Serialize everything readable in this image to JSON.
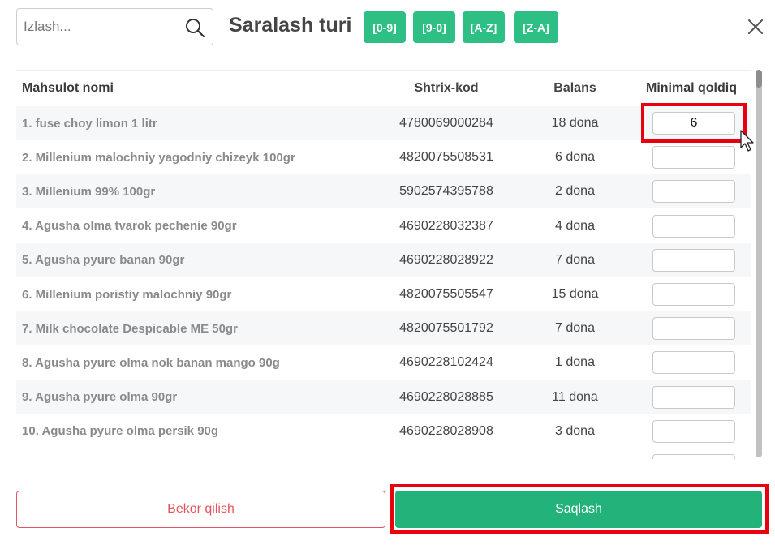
{
  "search": {
    "placeholder": "Izlash...",
    "icon": "search-icon"
  },
  "sort": {
    "title": "Saralash turi",
    "buttons": [
      "[0-9]",
      "[9-0]",
      "[A-Z]",
      "[Z-A]"
    ]
  },
  "close": {
    "icon": "close-icon"
  },
  "table": {
    "headers": [
      "Mahsulot nomi",
      "Shtrix-kod",
      "Balans",
      "Minimal qoldiq"
    ],
    "rows": [
      {
        "name": "1. fuse choy limon 1 litr",
        "barcode": "4780069000284",
        "balance": "18 dona",
        "min": "6"
      },
      {
        "name": "2. Millenium malochniy yagodniy chizeyk 100gr",
        "barcode": "4820075508531",
        "balance": "6 dona",
        "min": ""
      },
      {
        "name": "3. Millenium 99% 100gr",
        "barcode": "5902574395788",
        "balance": "2 dona",
        "min": ""
      },
      {
        "name": "4. Agusha olma tvarok pechenie 90gr",
        "barcode": "4690228032387",
        "balance": "4 dona",
        "min": ""
      },
      {
        "name": "5. Agusha pyure banan 90gr",
        "barcode": "4690228028922",
        "balance": "7 dona",
        "min": ""
      },
      {
        "name": "6. Millenium poristiy malochniy 90gr",
        "barcode": "4820075505547",
        "balance": "15 dona",
        "min": ""
      },
      {
        "name": "7. Milk chocolate Despicable ME 50gr",
        "barcode": "4820075501792",
        "balance": "7 dona",
        "min": ""
      },
      {
        "name": "8. Agusha pyure olma nok banan mango 90g",
        "barcode": "4690228102424",
        "balance": "1 dona",
        "min": ""
      },
      {
        "name": "9. Agusha pyure olma 90gr",
        "barcode": "4690228028885",
        "balance": "11 dona",
        "min": ""
      },
      {
        "name": "10. Agusha pyure olma persik 90g",
        "barcode": "4690228028908",
        "balance": "3 dona",
        "min": ""
      }
    ]
  },
  "footer": {
    "cancel_label": "Bekor qilish",
    "save_label": "Saqlash"
  },
  "colors": {
    "accent": "#2dbf84",
    "save": "#23b27a",
    "cancel": "#e2555e",
    "highlight": "#e8000f"
  }
}
